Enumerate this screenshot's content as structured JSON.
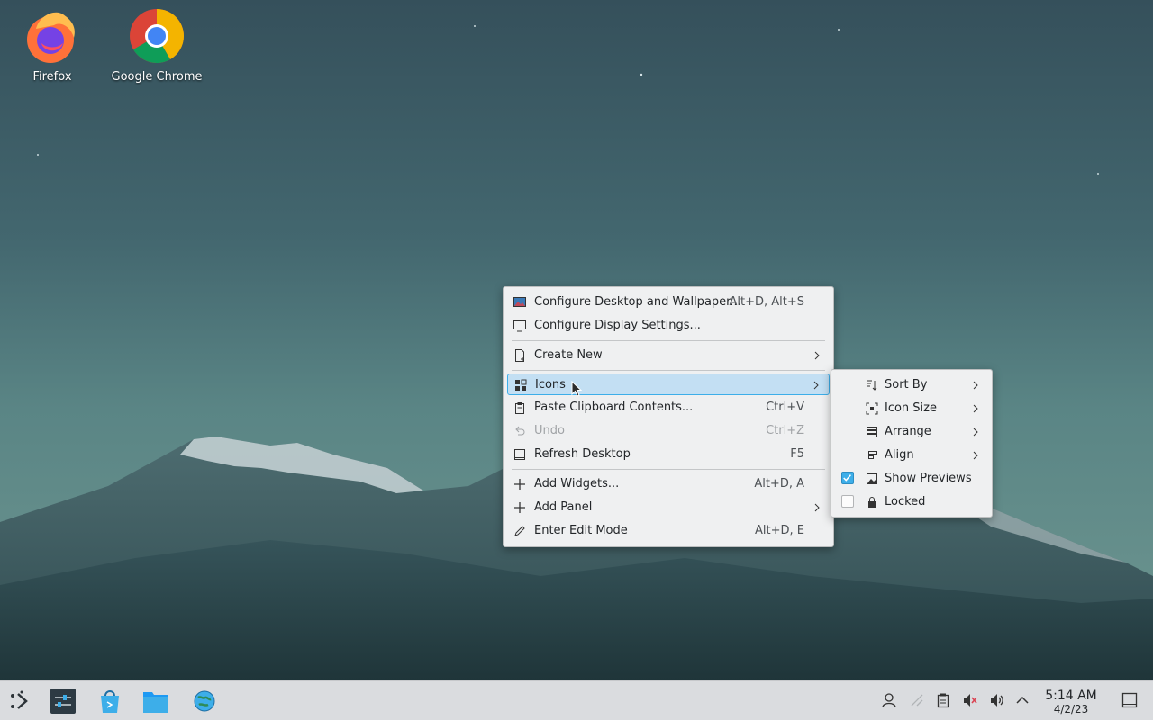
{
  "desktop": {
    "icons": [
      {
        "label": "Firefox",
        "icon": "firefox-icon"
      },
      {
        "label": "Google Chrome",
        "icon": "chrome-icon"
      }
    ]
  },
  "context_menu": {
    "items": [
      {
        "label": "Configure Desktop and Wallpaper...",
        "shortcut": "Alt+D, Alt+S",
        "icon": "wallpaper-icon"
      },
      {
        "label": "Configure Display Settings...",
        "shortcut": "",
        "icon": "monitor-icon"
      },
      {
        "label": "Create New",
        "shortcut": "",
        "icon": "new-document-icon",
        "submenu": true
      },
      {
        "label": "Icons",
        "shortcut": "",
        "icon": "icons-grid-icon",
        "submenu": true,
        "highlighted": true
      },
      {
        "label": "Paste Clipboard Contents...",
        "shortcut": "Ctrl+V",
        "icon": "clipboard-icon"
      },
      {
        "label": "Undo",
        "shortcut": "Ctrl+Z",
        "icon": "undo-icon",
        "disabled": true
      },
      {
        "label": "Refresh Desktop",
        "shortcut": "F5",
        "icon": "refresh-icon"
      },
      {
        "label": "Add Widgets...",
        "shortcut": "Alt+D, A",
        "icon": "plus-icon"
      },
      {
        "label": "Add Panel",
        "shortcut": "",
        "icon": "plus-icon",
        "submenu": true
      },
      {
        "label": "Enter Edit Mode",
        "shortcut": "Alt+D, E",
        "icon": "pencil-icon"
      }
    ]
  },
  "icons_submenu": {
    "items": [
      {
        "label": "Sort By",
        "icon": "sort-icon",
        "submenu": true
      },
      {
        "label": "Icon Size",
        "icon": "icon-size-icon",
        "submenu": true
      },
      {
        "label": "Arrange",
        "icon": "arrange-icon",
        "submenu": true
      },
      {
        "label": "Align",
        "icon": "align-icon",
        "submenu": true
      },
      {
        "label": "Show Previews",
        "icon": "image-icon",
        "checked": true
      },
      {
        "label": "Locked",
        "icon": "lock-icon",
        "checked": false
      }
    ]
  },
  "taskbar": {
    "apps": [
      "application-launcher-icon",
      "system-settings-icon",
      "discover-store-icon",
      "file-manager-icon",
      "web-browser-icon"
    ],
    "tray": [
      "user-icon",
      "network-icon",
      "clipboard-icon",
      "microphone-muted-icon",
      "volume-icon",
      "expand-tray-icon"
    ],
    "clock_time": "5:14 AM",
    "clock_date": "4/2/23"
  },
  "colors": {
    "accent": "#3daee9",
    "menu_bg": "#eff0f1",
    "panel_bg": "#dadcdf"
  }
}
